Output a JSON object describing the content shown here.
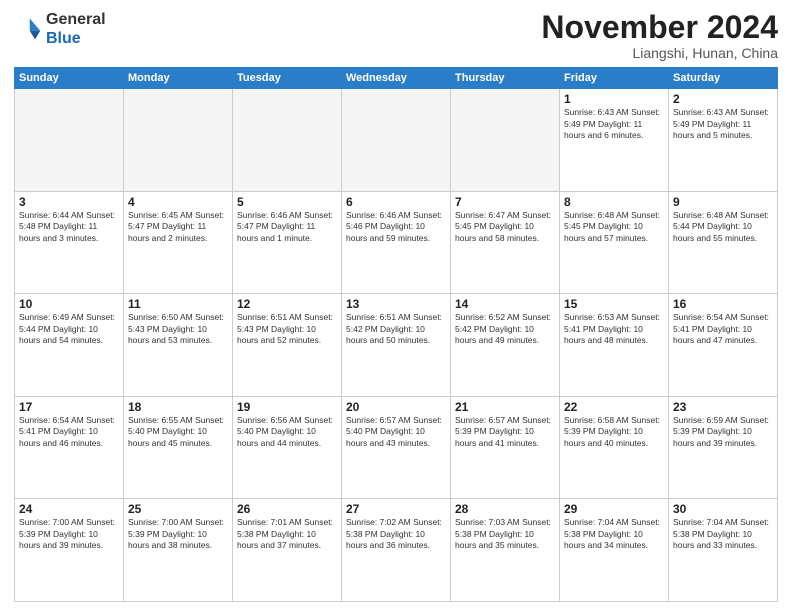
{
  "header": {
    "logo_general": "General",
    "logo_blue": "Blue",
    "month_title": "November 2024",
    "location": "Liangshi, Hunan, China"
  },
  "days_of_week": [
    "Sunday",
    "Monday",
    "Tuesday",
    "Wednesday",
    "Thursday",
    "Friday",
    "Saturday"
  ],
  "weeks": [
    [
      {
        "day": "",
        "info": ""
      },
      {
        "day": "",
        "info": ""
      },
      {
        "day": "",
        "info": ""
      },
      {
        "day": "",
        "info": ""
      },
      {
        "day": "",
        "info": ""
      },
      {
        "day": "1",
        "info": "Sunrise: 6:43 AM\nSunset: 5:49 PM\nDaylight: 11 hours\nand 6 minutes."
      },
      {
        "day": "2",
        "info": "Sunrise: 6:43 AM\nSunset: 5:49 PM\nDaylight: 11 hours\nand 5 minutes."
      }
    ],
    [
      {
        "day": "3",
        "info": "Sunrise: 6:44 AM\nSunset: 5:48 PM\nDaylight: 11 hours\nand 3 minutes."
      },
      {
        "day": "4",
        "info": "Sunrise: 6:45 AM\nSunset: 5:47 PM\nDaylight: 11 hours\nand 2 minutes."
      },
      {
        "day": "5",
        "info": "Sunrise: 6:46 AM\nSunset: 5:47 PM\nDaylight: 11 hours\nand 1 minute."
      },
      {
        "day": "6",
        "info": "Sunrise: 6:46 AM\nSunset: 5:46 PM\nDaylight: 10 hours\nand 59 minutes."
      },
      {
        "day": "7",
        "info": "Sunrise: 6:47 AM\nSunset: 5:45 PM\nDaylight: 10 hours\nand 58 minutes."
      },
      {
        "day": "8",
        "info": "Sunrise: 6:48 AM\nSunset: 5:45 PM\nDaylight: 10 hours\nand 57 minutes."
      },
      {
        "day": "9",
        "info": "Sunrise: 6:48 AM\nSunset: 5:44 PM\nDaylight: 10 hours\nand 55 minutes."
      }
    ],
    [
      {
        "day": "10",
        "info": "Sunrise: 6:49 AM\nSunset: 5:44 PM\nDaylight: 10 hours\nand 54 minutes."
      },
      {
        "day": "11",
        "info": "Sunrise: 6:50 AM\nSunset: 5:43 PM\nDaylight: 10 hours\nand 53 minutes."
      },
      {
        "day": "12",
        "info": "Sunrise: 6:51 AM\nSunset: 5:43 PM\nDaylight: 10 hours\nand 52 minutes."
      },
      {
        "day": "13",
        "info": "Sunrise: 6:51 AM\nSunset: 5:42 PM\nDaylight: 10 hours\nand 50 minutes."
      },
      {
        "day": "14",
        "info": "Sunrise: 6:52 AM\nSunset: 5:42 PM\nDaylight: 10 hours\nand 49 minutes."
      },
      {
        "day": "15",
        "info": "Sunrise: 6:53 AM\nSunset: 5:41 PM\nDaylight: 10 hours\nand 48 minutes."
      },
      {
        "day": "16",
        "info": "Sunrise: 6:54 AM\nSunset: 5:41 PM\nDaylight: 10 hours\nand 47 minutes."
      }
    ],
    [
      {
        "day": "17",
        "info": "Sunrise: 6:54 AM\nSunset: 5:41 PM\nDaylight: 10 hours\nand 46 minutes."
      },
      {
        "day": "18",
        "info": "Sunrise: 6:55 AM\nSunset: 5:40 PM\nDaylight: 10 hours\nand 45 minutes."
      },
      {
        "day": "19",
        "info": "Sunrise: 6:56 AM\nSunset: 5:40 PM\nDaylight: 10 hours\nand 44 minutes."
      },
      {
        "day": "20",
        "info": "Sunrise: 6:57 AM\nSunset: 5:40 PM\nDaylight: 10 hours\nand 43 minutes."
      },
      {
        "day": "21",
        "info": "Sunrise: 6:57 AM\nSunset: 5:39 PM\nDaylight: 10 hours\nand 41 minutes."
      },
      {
        "day": "22",
        "info": "Sunrise: 6:58 AM\nSunset: 5:39 PM\nDaylight: 10 hours\nand 40 minutes."
      },
      {
        "day": "23",
        "info": "Sunrise: 6:59 AM\nSunset: 5:39 PM\nDaylight: 10 hours\nand 39 minutes."
      }
    ],
    [
      {
        "day": "24",
        "info": "Sunrise: 7:00 AM\nSunset: 5:39 PM\nDaylight: 10 hours\nand 39 minutes."
      },
      {
        "day": "25",
        "info": "Sunrise: 7:00 AM\nSunset: 5:39 PM\nDaylight: 10 hours\nand 38 minutes."
      },
      {
        "day": "26",
        "info": "Sunrise: 7:01 AM\nSunset: 5:38 PM\nDaylight: 10 hours\nand 37 minutes."
      },
      {
        "day": "27",
        "info": "Sunrise: 7:02 AM\nSunset: 5:38 PM\nDaylight: 10 hours\nand 36 minutes."
      },
      {
        "day": "28",
        "info": "Sunrise: 7:03 AM\nSunset: 5:38 PM\nDaylight: 10 hours\nand 35 minutes."
      },
      {
        "day": "29",
        "info": "Sunrise: 7:04 AM\nSunset: 5:38 PM\nDaylight: 10 hours\nand 34 minutes."
      },
      {
        "day": "30",
        "info": "Sunrise: 7:04 AM\nSunset: 5:38 PM\nDaylight: 10 hours\nand 33 minutes."
      }
    ]
  ]
}
